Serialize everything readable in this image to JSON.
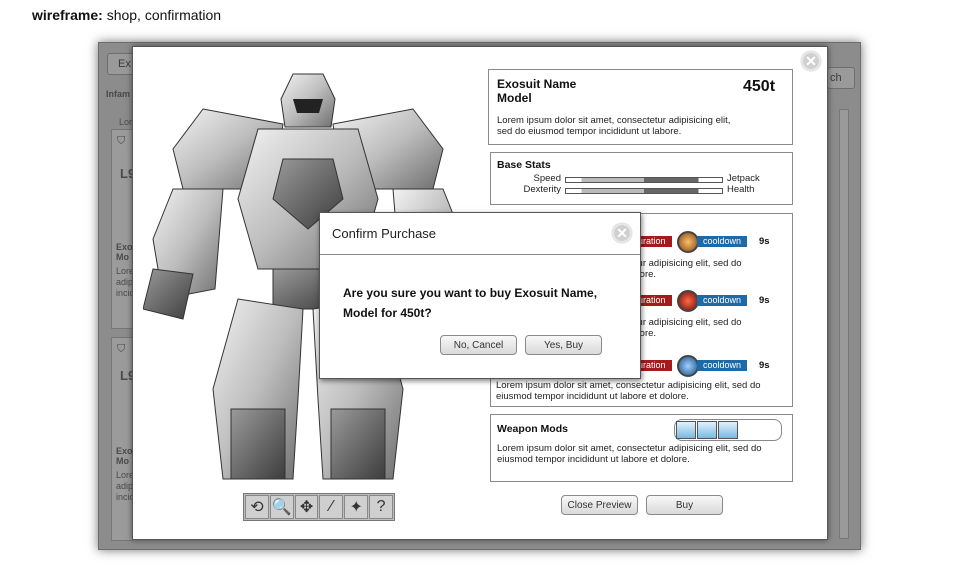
{
  "page": {
    "title_bold": "wireframe:",
    "title_rest": "shop, confirmation"
  },
  "background": {
    "tab_left": "Ex",
    "tab_right": "ch",
    "heading": "Infam",
    "lorem_short": "Lor",
    "card1": {
      "level": "L9",
      "name": "Exo",
      "model": "Mo",
      "lines": [
        "Lore",
        "adip",
        "incid"
      ]
    },
    "card2": {
      "level": "L9",
      "name": "Exo",
      "model": "Mo",
      "lines": [
        "Lore",
        "adip",
        "incid"
      ]
    }
  },
  "preview": {
    "name": "Exosuit Name",
    "model": "Model",
    "price": "450t",
    "description": "Lorem ipsum dolor sit amet, consectetur adipisicing elit, sed do eiusmod tempor incididunt ut labore.",
    "base_stats": {
      "title": "Base Stats",
      "left_labels": [
        "Speed",
        "Dexterity"
      ],
      "right_labels": [
        "Jetpack",
        "Health"
      ]
    },
    "abilities": [
      {
        "duration_label": "duration",
        "cooldown_label": "cooldown",
        "seconds": "9s",
        "text_line1": "tetur adipisicing elit, sed do",
        "text_line2": "dolore.",
        "orb_color": "#c8741e"
      },
      {
        "duration_label": "duration",
        "cooldown_label": "cooldown",
        "seconds": "9s",
        "text_line1": "tetur adipisicing elit, sed do",
        "text_line2": "dolore.",
        "orb_color": "#c0261b"
      },
      {
        "duration_label": "duration",
        "cooldown_label": "cooldown",
        "seconds": "9s",
        "text_line1": "Lorem ipsum dolor sit amet, consectetur adipisicing elit, sed do",
        "text_line2": "eiusmod tempor incididunt ut labore et dolore.",
        "orb_color": "#2a72b8"
      }
    ],
    "weapon_mods": {
      "title": "Weapon Mods",
      "text_line1": "Lorem ipsum dolor sit amet, consectetur adipisicing elit, sed do",
      "text_line2": "eiusmod tempor incididunt ut labore et dolore."
    },
    "close_preview_label": "Close Preview",
    "buy_label": "Buy",
    "toolbar_icons": [
      "rotate-icon",
      "zoom-icon",
      "move-icon",
      "weapon-icon",
      "grenade-icon",
      "help-icon"
    ],
    "toolbar_glyphs": [
      "⟲",
      "🔍",
      "✥",
      "⁄",
      "✦",
      "?"
    ]
  },
  "confirm": {
    "title": "Confirm Purchase",
    "message_line1": "Are you sure you want to buy Exosuit Name,",
    "message_line2": "Model for 450t?",
    "cancel_label": "No, Cancel",
    "confirm_label": "Yes, Buy"
  },
  "colors": {
    "duration": "#a51b1b",
    "cooldown": "#1d6aa8",
    "overlay": "#8c8c8c"
  }
}
